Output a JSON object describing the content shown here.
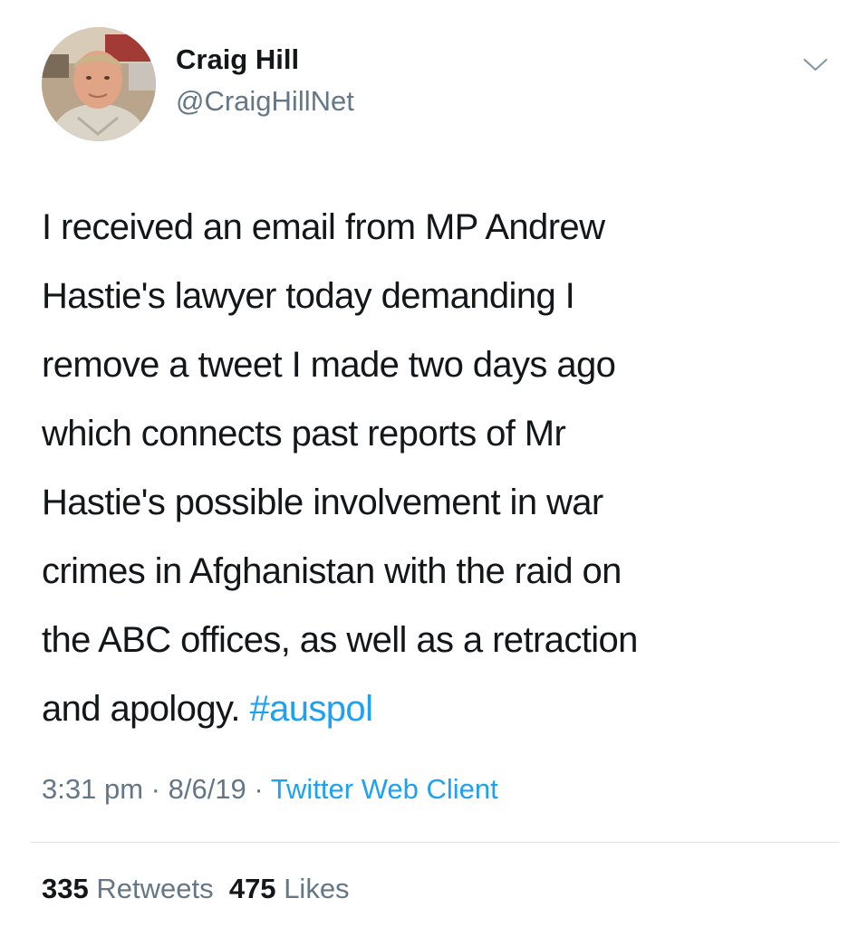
{
  "author": {
    "display_name": "Craig Hill",
    "handle": "@CraigHillNet",
    "avatar_icon": "profile-photo"
  },
  "menu": {
    "icon": "chevron-down-icon"
  },
  "tweet": {
    "lines": [
      "I received an email from MP Andrew",
      "Hastie's lawyer today demanding I",
      "remove a tweet I made two days ago",
      "which connects past reports of Mr",
      "Hastie's possible involvement in war",
      "crimes in Afghanistan with the raid on",
      "the ABC offices, as well as a retraction",
      "and apology."
    ],
    "hashtag": "#auspol"
  },
  "meta": {
    "time": "3:31 pm",
    "date": "8/6/19",
    "separator": "·",
    "source": "Twitter Web Client"
  },
  "stats": {
    "retweets_count": "335",
    "retweets_label": "Retweets",
    "likes_count": "475",
    "likes_label": "Likes"
  },
  "colors": {
    "link": "#1da1f2",
    "secondary_text": "#657786",
    "primary_text": "#14171a",
    "divider": "#dfe3e7"
  }
}
